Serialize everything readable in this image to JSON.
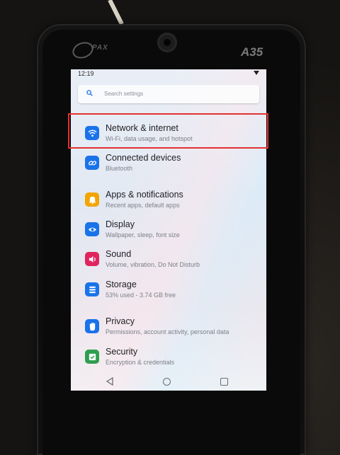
{
  "status_bar": {
    "time": "12:19"
  },
  "device": {
    "brand": "PAX",
    "model": "A35"
  },
  "search": {
    "placeholder": "Search settings"
  },
  "settings_items": [
    {
      "title": "Network & internet",
      "subtitle": "Wi-Fi, data usage, and hotspot",
      "icon": "wifi-icon",
      "color": "#1a73e8",
      "highlighted": true
    },
    {
      "title": "Connected devices",
      "subtitle": "Bluetooth",
      "icon": "devices-link-icon",
      "color": "#1a73e8"
    },
    {
      "title": "Apps & notifications",
      "subtitle": "Recent apps, default apps",
      "icon": "bell-icon",
      "color": "#f2a500"
    },
    {
      "title": "Display",
      "subtitle": "Wallpaper, sleep, font size",
      "icon": "display-eye-icon",
      "color": "#1a73e8"
    },
    {
      "title": "Sound",
      "subtitle": "Volume, vibration, Do Not Disturb",
      "icon": "speaker-icon",
      "color": "#e0245e"
    },
    {
      "title": "Storage",
      "subtitle": "53% used - 3.74 GB free",
      "icon": "storage-icon",
      "color": "#1a73e8"
    },
    {
      "title": "Privacy",
      "subtitle": "Permissions, account activity, personal data",
      "icon": "hand-icon",
      "color": "#1a73e8"
    },
    {
      "title": "Security",
      "subtitle": "Encryption & credentials",
      "icon": "shield-check-icon",
      "color": "#2e9e4f"
    }
  ],
  "highlight_color": "#e3312f"
}
